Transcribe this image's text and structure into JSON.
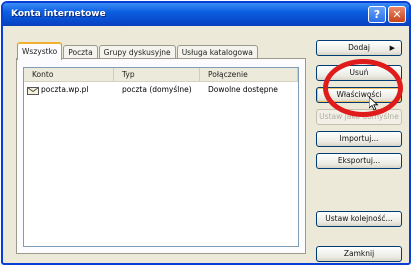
{
  "window": {
    "title": "Konta internetowe",
    "help_glyph": "?",
    "close_glyph": "✕"
  },
  "tabs": [
    {
      "label": "Wszystko",
      "active": true
    },
    {
      "label": "Poczta",
      "active": false
    },
    {
      "label": "Grupy dyskusyjne",
      "active": false
    },
    {
      "label": "Usługa katalogowa",
      "active": false
    }
  ],
  "list": {
    "columns": [
      "Konto",
      "Typ",
      "Połączenie"
    ],
    "rows": [
      {
        "account": "poczta.wp.pl",
        "type": "poczta (domyślne)",
        "connection": "Dowolne dostępne",
        "icon": "mail-account-icon"
      }
    ]
  },
  "buttons": {
    "add": "Dodaj",
    "remove": "Usuń",
    "properties": "Właściwości",
    "set_default": "Ustaw jako domyślne",
    "import": "Importuj...",
    "export": "Eksportuj...",
    "set_order": "Ustaw kolejność...",
    "close": "Zamknij"
  },
  "colors": {
    "title_bar": "#0b5fe0",
    "highlight_circle": "#e01b1b",
    "active_tab_accent": "#f0b030"
  }
}
